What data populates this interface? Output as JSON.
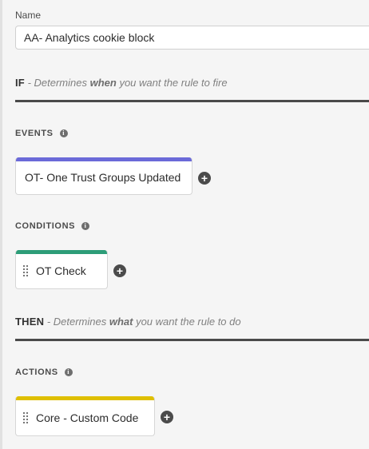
{
  "name_field": {
    "label": "Name",
    "value": "AA- Analytics cookie block"
  },
  "if_section": {
    "keyword": "IF",
    "desc_prefix": " - Determines ",
    "desc_strong": "when",
    "desc_suffix": " you want the rule to fire"
  },
  "events": {
    "header": "EVENTS",
    "items": [
      {
        "label": "OT- One Trust Groups Updated",
        "color": "#6b6ad8"
      }
    ]
  },
  "conditions": {
    "header": "CONDITIONS",
    "items": [
      {
        "label": "OT Check",
        "color": "#2d9d78"
      }
    ]
  },
  "then_section": {
    "keyword": "THEN",
    "desc_prefix": " - Determines ",
    "desc_strong": "what",
    "desc_suffix": " you want the rule to do"
  },
  "actions": {
    "header": "ACTIONS",
    "items": [
      {
        "label": "Core - Custom Code",
        "color": "#dfbf00"
      }
    ]
  },
  "icons": {
    "info": "info-icon",
    "add": "plus-circle-icon",
    "drag": "drag-handle-icon"
  }
}
